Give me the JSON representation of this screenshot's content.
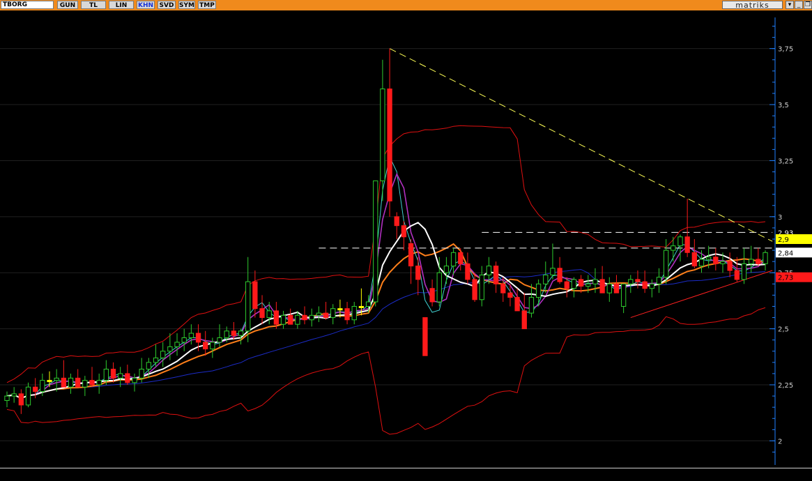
{
  "toolbar": {
    "symbol": "TBORG",
    "buttons": [
      "GUN",
      "TL",
      "LIN",
      "KHN",
      "SVD",
      "SYM",
      "TMP"
    ],
    "active": "KHN",
    "brand": "matriks",
    "dropdown_icon": "chevron-down-icon",
    "minimize_icon": "minimize-icon",
    "restore_icon": "restore-icon",
    "colors": {
      "bar": "#f08a1c",
      "button": "#d8d8d8",
      "active_text": "#1430d8"
    }
  },
  "chart_data": {
    "type": "candlestick",
    "ylim": [
      1.88,
      3.92
    ],
    "yticks": [
      2,
      2.25,
      2.5,
      2.75,
      3,
      3.25,
      3.5,
      3.75
    ],
    "ytick_labels": [
      "2",
      "2,25",
      "2,5",
      "2,75",
      "3",
      "3,25",
      "3,5",
      "3,75"
    ],
    "price_labels": [
      {
        "text": "2,93",
        "value": 2.93,
        "bg": "#000000",
        "fg": "#ffffff"
      },
      {
        "text": "2,9",
        "value": 2.9,
        "bg": "#ffff00",
        "fg": "#000000"
      },
      {
        "text": "2,84",
        "value": 2.84,
        "bg": "#ffffff",
        "fg": "#000000"
      },
      {
        "text": "2,73",
        "value": 2.73,
        "bg": "#ff1a1a",
        "fg": "#000000"
      }
    ],
    "colors": {
      "up": "#2ecc2e",
      "down": "#ff1a1a",
      "neutral": "#ffff00",
      "axis": "#2080ff",
      "grid": "#202020"
    },
    "candles": [
      [
        2.18,
        2.22,
        2.15,
        2.2
      ],
      [
        2.2,
        2.24,
        2.17,
        2.21
      ],
      [
        2.21,
        2.23,
        2.12,
        2.16
      ],
      [
        2.16,
        2.26,
        2.15,
        2.24
      ],
      [
        2.24,
        2.28,
        2.19,
        2.22
      ],
      [
        2.22,
        2.3,
        2.2,
        2.27
      ],
      [
        2.27,
        2.31,
        2.24,
        2.27
      ],
      [
        2.27,
        2.32,
        2.22,
        2.28
      ],
      [
        2.28,
        2.36,
        2.25,
        2.24
      ],
      [
        2.24,
        2.3,
        2.21,
        2.28
      ],
      [
        2.28,
        2.32,
        2.24,
        2.24
      ],
      [
        2.24,
        2.29,
        2.2,
        2.27
      ],
      [
        2.27,
        2.33,
        2.24,
        2.25
      ],
      [
        2.25,
        2.3,
        2.21,
        2.27
      ],
      [
        2.27,
        2.36,
        2.25,
        2.32
      ],
      [
        2.32,
        2.35,
        2.26,
        2.28
      ],
      [
        2.28,
        2.33,
        2.24,
        2.3
      ],
      [
        2.3,
        2.34,
        2.25,
        2.26
      ],
      [
        2.26,
        2.3,
        2.22,
        2.28
      ],
      [
        2.28,
        2.37,
        2.26,
        2.32
      ],
      [
        2.32,
        2.37,
        2.28,
        2.35
      ],
      [
        2.35,
        2.43,
        2.33,
        2.37
      ],
      [
        2.37,
        2.44,
        2.33,
        2.4
      ],
      [
        2.4,
        2.48,
        2.36,
        2.42
      ],
      [
        2.42,
        2.48,
        2.38,
        2.44
      ],
      [
        2.44,
        2.5,
        2.4,
        2.46
      ],
      [
        2.46,
        2.52,
        2.43,
        2.48
      ],
      [
        2.48,
        2.52,
        2.4,
        2.44
      ],
      [
        2.44,
        2.49,
        2.38,
        2.41
      ],
      [
        2.41,
        2.46,
        2.37,
        2.44
      ],
      [
        2.44,
        2.52,
        2.42,
        2.46
      ],
      [
        2.46,
        2.51,
        2.44,
        2.49
      ],
      [
        2.49,
        2.53,
        2.45,
        2.47
      ],
      [
        2.47,
        2.5,
        2.43,
        2.49
      ],
      [
        2.49,
        2.82,
        2.44,
        2.71
      ],
      [
        2.71,
        2.76,
        2.55,
        2.59
      ],
      [
        2.59,
        2.65,
        2.52,
        2.55
      ],
      [
        2.55,
        2.62,
        2.52,
        2.58
      ],
      [
        2.58,
        2.62,
        2.5,
        2.52
      ],
      [
        2.52,
        2.58,
        2.5,
        2.56
      ],
      [
        2.56,
        2.59,
        2.52,
        2.52
      ],
      [
        2.52,
        2.58,
        2.5,
        2.56
      ],
      [
        2.56,
        2.6,
        2.52,
        2.54
      ],
      [
        2.54,
        2.59,
        2.51,
        2.56
      ],
      [
        2.56,
        2.6,
        2.53,
        2.57
      ],
      [
        2.57,
        2.62,
        2.54,
        2.55
      ],
      [
        2.55,
        2.61,
        2.52,
        2.59
      ],
      [
        2.59,
        2.63,
        2.55,
        2.59
      ],
      [
        2.59,
        2.62,
        2.52,
        2.54
      ],
      [
        2.54,
        2.62,
        2.52,
        2.6
      ],
      [
        2.6,
        2.68,
        2.56,
        2.6
      ],
      [
        2.6,
        2.65,
        2.57,
        2.62
      ],
      [
        2.62,
        3.16,
        2.6,
        3.16
      ],
      [
        3.16,
        3.7,
        3.07,
        3.57
      ],
      [
        3.57,
        3.75,
        3.0,
        3.07
      ],
      [
        3.0,
        3.02,
        2.9,
        2.96
      ],
      [
        2.96,
        2.98,
        2.85,
        2.91
      ],
      [
        2.88,
        2.9,
        2.7,
        2.78
      ],
      [
        2.78,
        2.82,
        2.65,
        2.72
      ],
      [
        2.55,
        2.54,
        2.4,
        2.38
      ],
      [
        2.68,
        2.72,
        2.6,
        2.62
      ],
      [
        2.62,
        2.82,
        2.6,
        2.75
      ],
      [
        2.75,
        2.82,
        2.7,
        2.78
      ],
      [
        2.78,
        2.86,
        2.74,
        2.84
      ],
      [
        2.84,
        2.86,
        2.76,
        2.79
      ],
      [
        2.79,
        2.84,
        2.7,
        2.72
      ],
      [
        2.72,
        2.75,
        2.62,
        2.63
      ],
      [
        2.63,
        2.78,
        2.6,
        2.74
      ],
      [
        2.74,
        2.82,
        2.7,
        2.78
      ],
      [
        2.78,
        2.8,
        2.66,
        2.7
      ],
      [
        2.7,
        2.73,
        2.62,
        2.66
      ],
      [
        2.66,
        2.7,
        2.6,
        2.64
      ],
      [
        2.64,
        2.68,
        2.58,
        2.58
      ],
      [
        2.58,
        2.66,
        2.5,
        2.5
      ],
      [
        2.57,
        2.7,
        2.55,
        2.64
      ],
      [
        2.64,
        2.72,
        2.6,
        2.7
      ],
      [
        2.7,
        2.8,
        2.66,
        2.74
      ],
      [
        2.74,
        2.88,
        2.72,
        2.77
      ],
      [
        2.77,
        2.82,
        2.7,
        2.71
      ],
      [
        2.71,
        2.73,
        2.64,
        2.68
      ],
      [
        2.68,
        2.73,
        2.64,
        2.72
      ],
      [
        2.72,
        2.74,
        2.66,
        2.69
      ],
      [
        2.69,
        2.74,
        2.66,
        2.7
      ],
      [
        2.7,
        2.77,
        2.66,
        2.72
      ],
      [
        2.72,
        2.78,
        2.68,
        2.66
      ],
      [
        2.66,
        2.73,
        2.62,
        2.7
      ],
      [
        2.7,
        2.74,
        2.66,
        2.66
      ],
      [
        2.6,
        2.7,
        2.57,
        2.7
      ],
      [
        2.7,
        2.74,
        2.66,
        2.72
      ],
      [
        2.72,
        2.76,
        2.68,
        2.71
      ],
      [
        2.71,
        2.76,
        2.66,
        2.68
      ],
      [
        2.68,
        2.72,
        2.64,
        2.7
      ],
      [
        2.7,
        2.77,
        2.66,
        2.73
      ],
      [
        2.73,
        2.9,
        2.7,
        2.85
      ],
      [
        2.85,
        2.91,
        2.8,
        2.87
      ],
      [
        2.87,
        2.92,
        2.8,
        2.91
      ],
      [
        2.91,
        3.08,
        2.82,
        2.84
      ],
      [
        2.84,
        2.9,
        2.77,
        2.78
      ],
      [
        2.78,
        2.85,
        2.75,
        2.81
      ],
      [
        2.81,
        2.87,
        2.77,
        2.82
      ],
      [
        2.82,
        2.86,
        2.76,
        2.79
      ],
      [
        2.79,
        2.84,
        2.75,
        2.8
      ],
      [
        2.8,
        2.84,
        2.73,
        2.76
      ],
      [
        2.76,
        2.82,
        2.71,
        2.72
      ],
      [
        2.72,
        2.86,
        2.7,
        2.79
      ],
      [
        2.79,
        2.87,
        2.75,
        2.81
      ],
      [
        2.81,
        2.86,
        2.78,
        2.79
      ],
      [
        2.79,
        2.85,
        2.76,
        2.84
      ]
    ],
    "trendline": {
      "from": [
        54,
        3.75
      ],
      "to": [
        108,
        2.89
      ],
      "color": "#ffff55"
    },
    "horizontal_levels": [
      {
        "from": 44,
        "to": 108,
        "value": 2.86
      },
      {
        "from": 67,
        "to": 108,
        "value": 2.93
      }
    ],
    "support_line": {
      "from": [
        88,
        2.55
      ],
      "to": [
        108,
        2.76
      ],
      "color": "#ff2020"
    }
  }
}
